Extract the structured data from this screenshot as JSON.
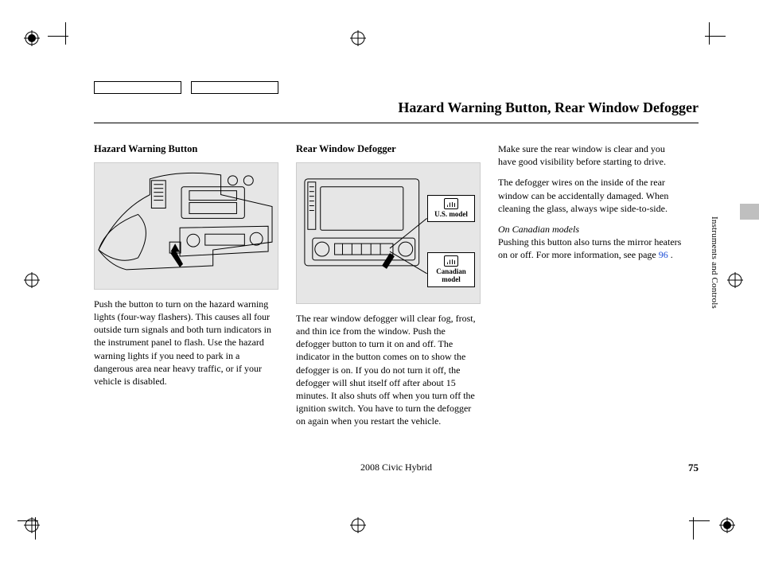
{
  "page": {
    "title": "Hazard Warning Button, Rear Window Defogger",
    "doc_footer": "2008  Civic  Hybrid",
    "page_number": "75",
    "section_tab": "Instruments and Controls"
  },
  "col1": {
    "heading": "Hazard Warning Button",
    "para1": "Push the button to turn on the hazard warning lights (four-way flashers). This causes all four outside turn signals and both turn indicators in the instrument panel to flash. Use the hazard warning lights if you need to park in a dangerous area near heavy traffic, or if your vehicle is disabled."
  },
  "col2": {
    "heading": "Rear Window Defogger",
    "label_us": "U.S. model",
    "label_ca": "Canadian model",
    "para1": "The rear window defogger will clear fog, frost, and thin ice from the window. Push the defogger button to turn it on and off. The indicator in the button comes on to show the defogger is on. If you do not turn it off, the defogger will shut itself off after about 15 minutes. It also shuts off when you turn off the ignition switch. You have to turn the defogger on again when you restart the vehicle."
  },
  "col3": {
    "para1": "Make sure the rear window is clear and you have good visibility before starting to drive.",
    "para2": "The defogger wires on the inside of the rear window can be accidentally damaged. When cleaning the glass, always wipe side-to-side.",
    "note_label": "On Canadian models",
    "para3_a": "Pushing this button also turns the mirror heaters on or off. For more information, see page  ",
    "page_ref": "96",
    "para3_b": " ."
  }
}
